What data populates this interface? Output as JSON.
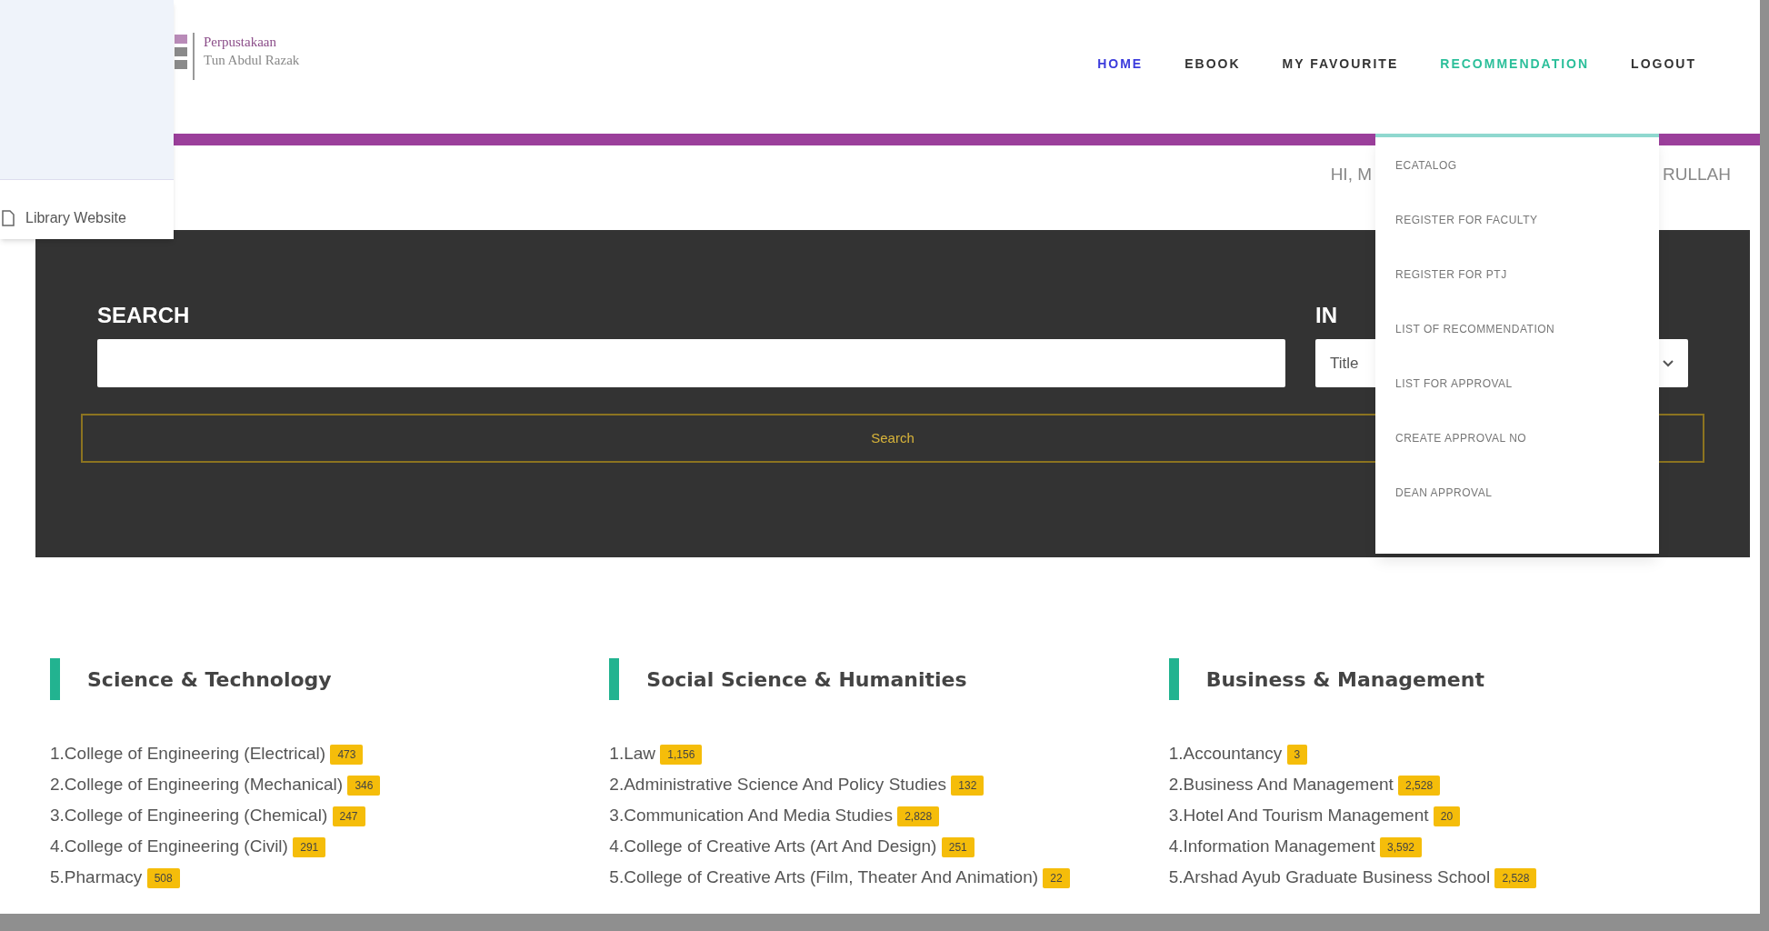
{
  "popup": {
    "link": "Library Website"
  },
  "logo": {
    "line_1": "Perpustakaan",
    "line_2": "Tun Abdul Razak"
  },
  "nav": [
    {
      "label": "HOME",
      "selected": true,
      "kind": "link"
    },
    {
      "label": "EBOOK",
      "selected": false,
      "kind": "link"
    },
    {
      "label": "MY FAVOURITE",
      "selected": false,
      "kind": "link"
    },
    {
      "label": "RECOMMENDATION",
      "selected": false,
      "kind": "open"
    },
    {
      "label": "LOGOUT",
      "selected": false,
      "kind": "link"
    }
  ],
  "greeting": {
    "start": "HI, M",
    "end": "RULLAH"
  },
  "dropdown": [
    "ECATALOG",
    "REGISTER FOR FACULTY",
    "REGISTER FOR PTJ",
    "LIST OF RECOMMENDATION",
    "LIST FOR APPROVAL",
    "CREATE APPROVAL NO",
    "DEAN APPROVAL"
  ],
  "search": {
    "label": "SEARCH",
    "in_label": "IN",
    "in_value": "Title",
    "button": "Search"
  },
  "sections": [
    {
      "title": "Science & Technology",
      "items": [
        {
          "name": "1.College of Engineering (Electrical)",
          "count": "473"
        },
        {
          "name": "2.College of Engineering (Mechanical)",
          "count": "346"
        },
        {
          "name": "3.College of Engineering (Chemical)",
          "count": "247"
        },
        {
          "name": "4.College of Engineering (Civil)",
          "count": "291"
        },
        {
          "name": "5.Pharmacy",
          "count": "508"
        }
      ]
    },
    {
      "title": "Social Science & Humanities",
      "items": [
        {
          "name": "1.Law",
          "count": "1,156"
        },
        {
          "name": "2.Administrative Science And Policy Studies",
          "count": "132"
        },
        {
          "name": "3.Communication And Media Studies",
          "count": "2,828"
        },
        {
          "name": "4.College of Creative Arts (Art And Design)",
          "count": "251"
        },
        {
          "name": "5.College of Creative Arts (Film, Theater And Animation)",
          "count": "22"
        }
      ]
    },
    {
      "title": "Business & Management",
      "items": [
        {
          "name": "1.Accountancy",
          "count": "3"
        },
        {
          "name": "2.Business And Management",
          "count": "2,528"
        },
        {
          "name": "3.Hotel And Tourism Management",
          "count": "20"
        },
        {
          "name": "4.Information Management",
          "count": "3,592"
        },
        {
          "name": "5.Arshad Ayub Graduate Business School",
          "count": "2,528"
        }
      ]
    }
  ]
}
